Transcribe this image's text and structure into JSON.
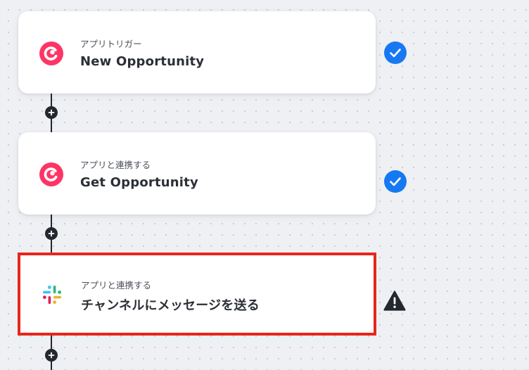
{
  "colors": {
    "check_badge": "#1679f2",
    "warning": "#23272e",
    "selected_border": "#e8251b",
    "connector": "#23272e"
  },
  "steps": [
    {
      "app": "copper",
      "app_icon": "copper-logo-icon",
      "label": "アプリトリガー",
      "title": "New Opportunity",
      "status": "completed",
      "status_icon": "check-circle-icon"
    },
    {
      "app": "copper",
      "app_icon": "copper-logo-icon",
      "label": "アプリと連携する",
      "title": "Get Opportunity",
      "status": "completed",
      "status_icon": "check-circle-icon"
    },
    {
      "app": "slack",
      "app_icon": "slack-logo-icon",
      "label": "アプリと連携する",
      "title": "チャンネルにメッセージを送る",
      "status": "warning",
      "status_icon": "warning-triangle-icon",
      "selected": true
    }
  ],
  "add_step_icon": "plus-icon"
}
